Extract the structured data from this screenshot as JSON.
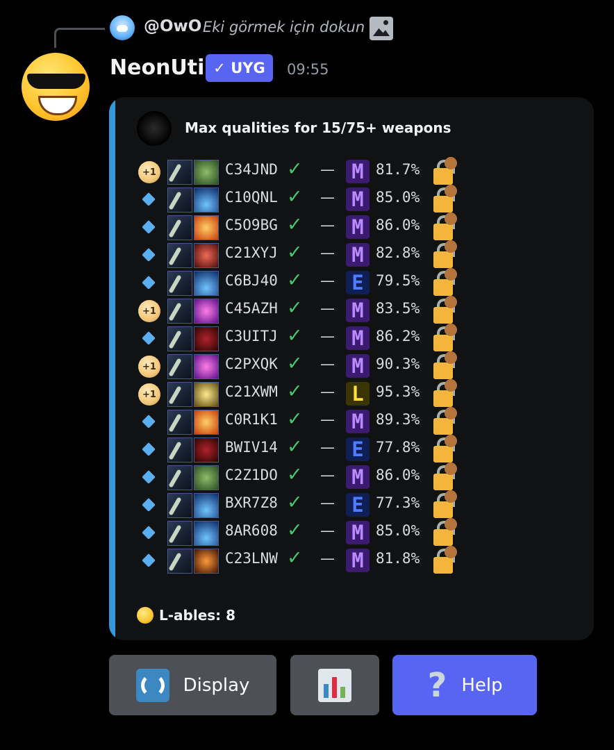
{
  "reply": {
    "username": "@OwO",
    "text": "Eki görmek için dokun"
  },
  "message": {
    "author": "NeonUtil",
    "badge": "✓ UYG",
    "timestamp": "09:55"
  },
  "embed": {
    "accent_color": "#3498db",
    "author": "Max qualities for 15/75+ weapons",
    "rows": [
      {
        "bullet": "+1",
        "code": "C34JND",
        "rank": "M",
        "percent": "81.7%"
      },
      {
        "bullet": "diamond",
        "code": "C10QNL",
        "rank": "M",
        "percent": "85.0%"
      },
      {
        "bullet": "diamond",
        "code": "C5O9BG",
        "rank": "M",
        "percent": "86.0%"
      },
      {
        "bullet": "diamond",
        "code": "C21XYJ",
        "rank": "M",
        "percent": "82.8%"
      },
      {
        "bullet": "diamond",
        "code": "C6BJ40",
        "rank": "E",
        "percent": "79.5%"
      },
      {
        "bullet": "+1",
        "code": "C45AZH",
        "rank": "M",
        "percent": "83.5%"
      },
      {
        "bullet": "diamond",
        "code": "C3UITJ",
        "rank": "M",
        "percent": "86.2%"
      },
      {
        "bullet": "+1",
        "code": "C2PXQK",
        "rank": "M",
        "percent": "90.3%"
      },
      {
        "bullet": "+1",
        "code": "C21XWM",
        "rank": "L",
        "percent": "95.3%"
      },
      {
        "bullet": "diamond",
        "code": "C0R1K1",
        "rank": "M",
        "percent": "89.3%"
      },
      {
        "bullet": "diamond",
        "code": "BWIV14",
        "rank": "E",
        "percent": "77.8%"
      },
      {
        "bullet": "diamond",
        "code": "C2Z1DO",
        "rank": "M",
        "percent": "86.0%"
      },
      {
        "bullet": "diamond",
        "code": "BXR7Z8",
        "rank": "E",
        "percent": "77.3%"
      },
      {
        "bullet": "diamond",
        "code": "8AR608",
        "rank": "M",
        "percent": "85.0%"
      },
      {
        "bullet": "diamond",
        "code": "C23LNW",
        "rank": "M",
        "percent": "81.8%"
      }
    ],
    "footer": "L-ables: 8"
  },
  "buttons": {
    "display_label": "Display",
    "help_label": "Help",
    "help_glyph": "?"
  },
  "colors": {
    "blurple": "#5865f2",
    "secondary_button": "#4e5058",
    "check": "#3fcb6a"
  }
}
